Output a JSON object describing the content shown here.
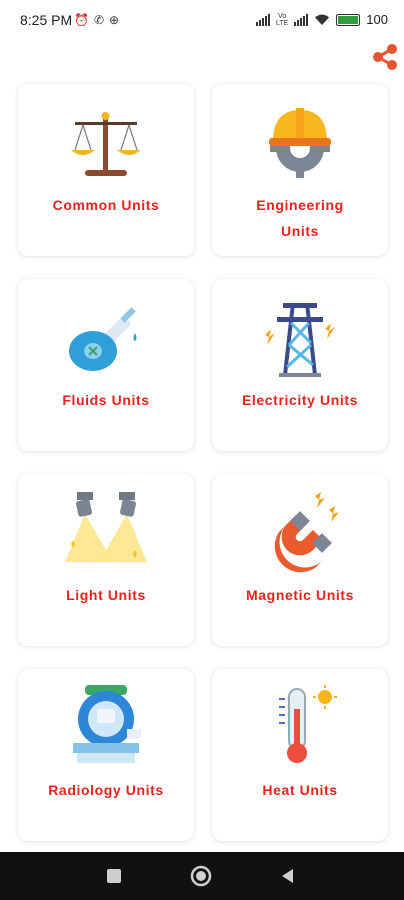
{
  "status_bar": {
    "time": "8:25 PM",
    "battery_text": "100",
    "left_icons": [
      "alarm-icon",
      "whatsapp-icon",
      "vpn-icon"
    ],
    "right_icons": [
      "signal-icon",
      "volte-icon",
      "signal-icon",
      "wifi-icon",
      "battery-icon"
    ]
  },
  "header": {
    "share_icon": "share-icon",
    "accent_color": "#e8532f"
  },
  "cards": [
    {
      "label": "Common Units",
      "icon": "scale-icon"
    },
    {
      "label": "Engineering Units",
      "icon": "engineering-icon"
    },
    {
      "label": "Fluids Units",
      "icon": "fluid-bulb-icon"
    },
    {
      "label": "Electricity Units",
      "icon": "transmission-tower-icon"
    },
    {
      "label": "Light Units",
      "icon": "spotlight-icon"
    },
    {
      "label": "Magnetic Units",
      "icon": "magnet-icon"
    },
    {
      "label": "Radiology Units",
      "icon": "radiology-machine-icon"
    },
    {
      "label": "Heat Units",
      "icon": "thermometer-icon"
    }
  ],
  "label_color": "#e8231d",
  "nav_bar": {
    "icons": [
      "recents-icon",
      "home-icon",
      "back-icon"
    ]
  }
}
